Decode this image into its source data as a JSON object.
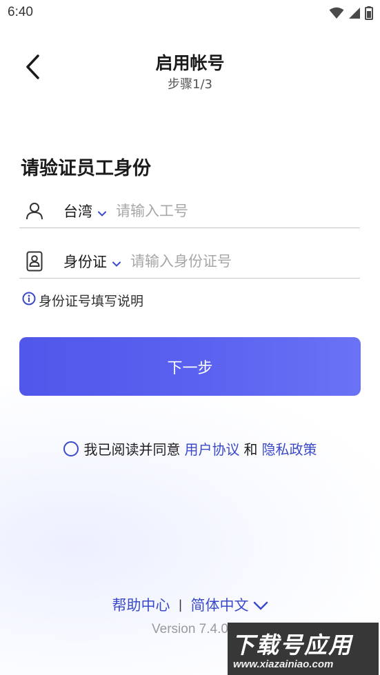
{
  "status_bar": {
    "time": "6:40",
    "icons": [
      "wifi-icon",
      "signal-icon",
      "battery-icon"
    ]
  },
  "header": {
    "title": "启用帐号",
    "subtitle": "步骤1/3"
  },
  "form": {
    "section_title": "请验证员工身份",
    "employee_row": {
      "icon": "person-icon",
      "region_value": "台湾",
      "placeholder": "请输入工号",
      "value": ""
    },
    "id_row": {
      "icon": "id-card-icon",
      "id_type_value": "身份证",
      "placeholder": "请输入身份证号",
      "value": ""
    },
    "help_link": "身份证号填写说明"
  },
  "next_button": "下一步",
  "agreement": {
    "checked": false,
    "prefix": "我已阅读并同意",
    "user_agreement": "用户协议",
    "and": "和",
    "privacy_policy": "隐私政策"
  },
  "footer": {
    "help_center": "帮助中心",
    "separator": "|",
    "language": "简体中文",
    "version": "Version 7.4.0"
  },
  "watermark": {
    "main": "下载号应用",
    "sub": "www.xiazainiao.com"
  },
  "colors": {
    "accent": "#3a49c9",
    "button": "#5057ea",
    "text": "#1a1a1a",
    "placeholder": "#a7a7a7"
  }
}
